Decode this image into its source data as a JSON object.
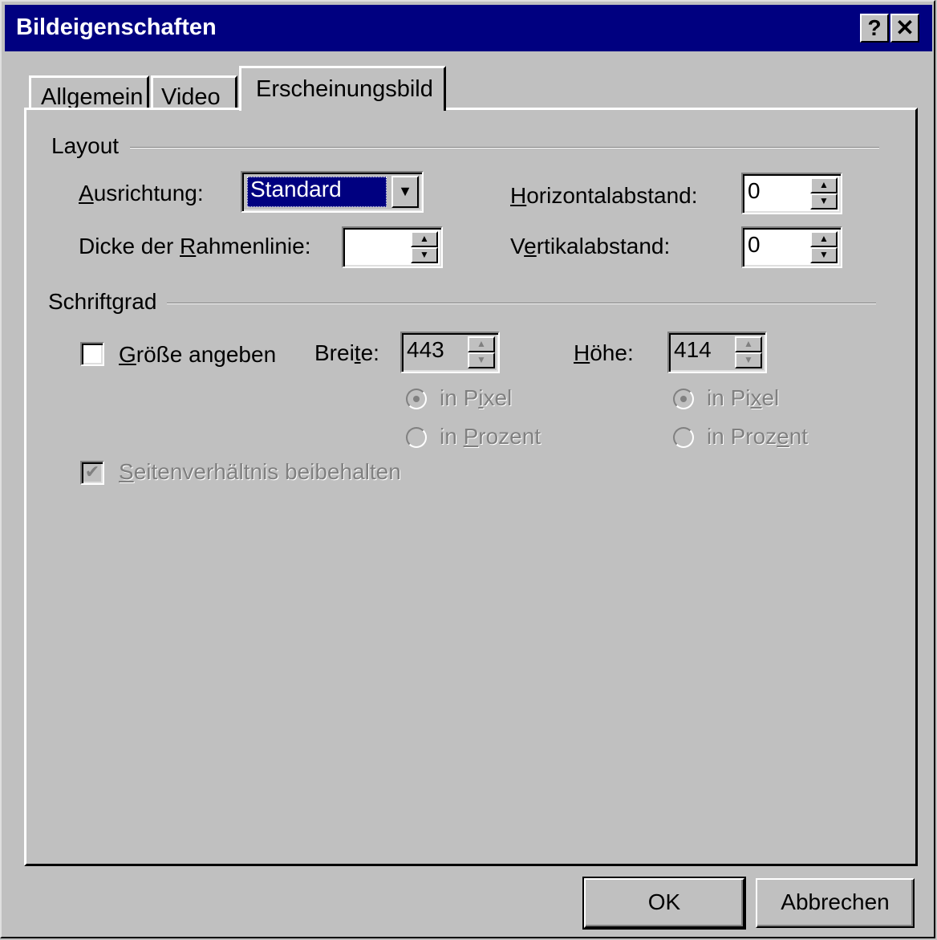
{
  "window": {
    "title": "Bildeigenschaften",
    "help_button": "?",
    "close_button": "✕"
  },
  "tabs": [
    {
      "label": "Allgemein",
      "active": false
    },
    {
      "label": "Video",
      "active": false
    },
    {
      "label": "Erscheinungsbild",
      "active": true
    }
  ],
  "layout_group": {
    "title": "Layout",
    "alignment": {
      "label_pre": "",
      "label_u": "A",
      "label_post": "usrichtung:",
      "value": "Standard"
    },
    "border": {
      "label_pre": "Dicke der ",
      "label_u": "R",
      "label_post": "ahmenlinie:",
      "value": ""
    },
    "hspace": {
      "label_pre": "",
      "label_u": "H",
      "label_post": "orizontalabstand:",
      "value": "0"
    },
    "vspace": {
      "label_pre": "V",
      "label_u": "e",
      "label_post": "rtikalabstand:",
      "value": "0"
    }
  },
  "size_group": {
    "title": "Schriftgrad",
    "specify_size": {
      "label_pre": "",
      "label_u": "G",
      "label_post": "röße angeben",
      "checked": false
    },
    "width": {
      "label_pre": "Brei",
      "label_u": "t",
      "label_post": "e:",
      "value": "443"
    },
    "height": {
      "label_pre": "",
      "label_u": "H",
      "label_post": "öhe:",
      "value": "414"
    },
    "width_units": {
      "pixel": {
        "label_pre": "in P",
        "label_u": "i",
        "label_post": "xel",
        "selected": true
      },
      "percent": {
        "label_pre": "in ",
        "label_u": "P",
        "label_post": "rozent",
        "selected": false
      }
    },
    "height_units": {
      "pixel": {
        "label_pre": "in Pi",
        "label_u": "x",
        "label_post": "el",
        "selected": true
      },
      "percent": {
        "label_pre": "in Proz",
        "label_u": "e",
        "label_post": "nt",
        "selected": false
      }
    },
    "keep_ratio": {
      "label_pre": "",
      "label_u": "S",
      "label_post": "eitenverhältnis beibehalten",
      "checked": true
    }
  },
  "buttons": {
    "ok": "OK",
    "cancel": "Abbrechen"
  },
  "icons": {
    "dropdown": "▼",
    "spin_up": "▲",
    "spin_down": "▼",
    "check": "✔"
  }
}
